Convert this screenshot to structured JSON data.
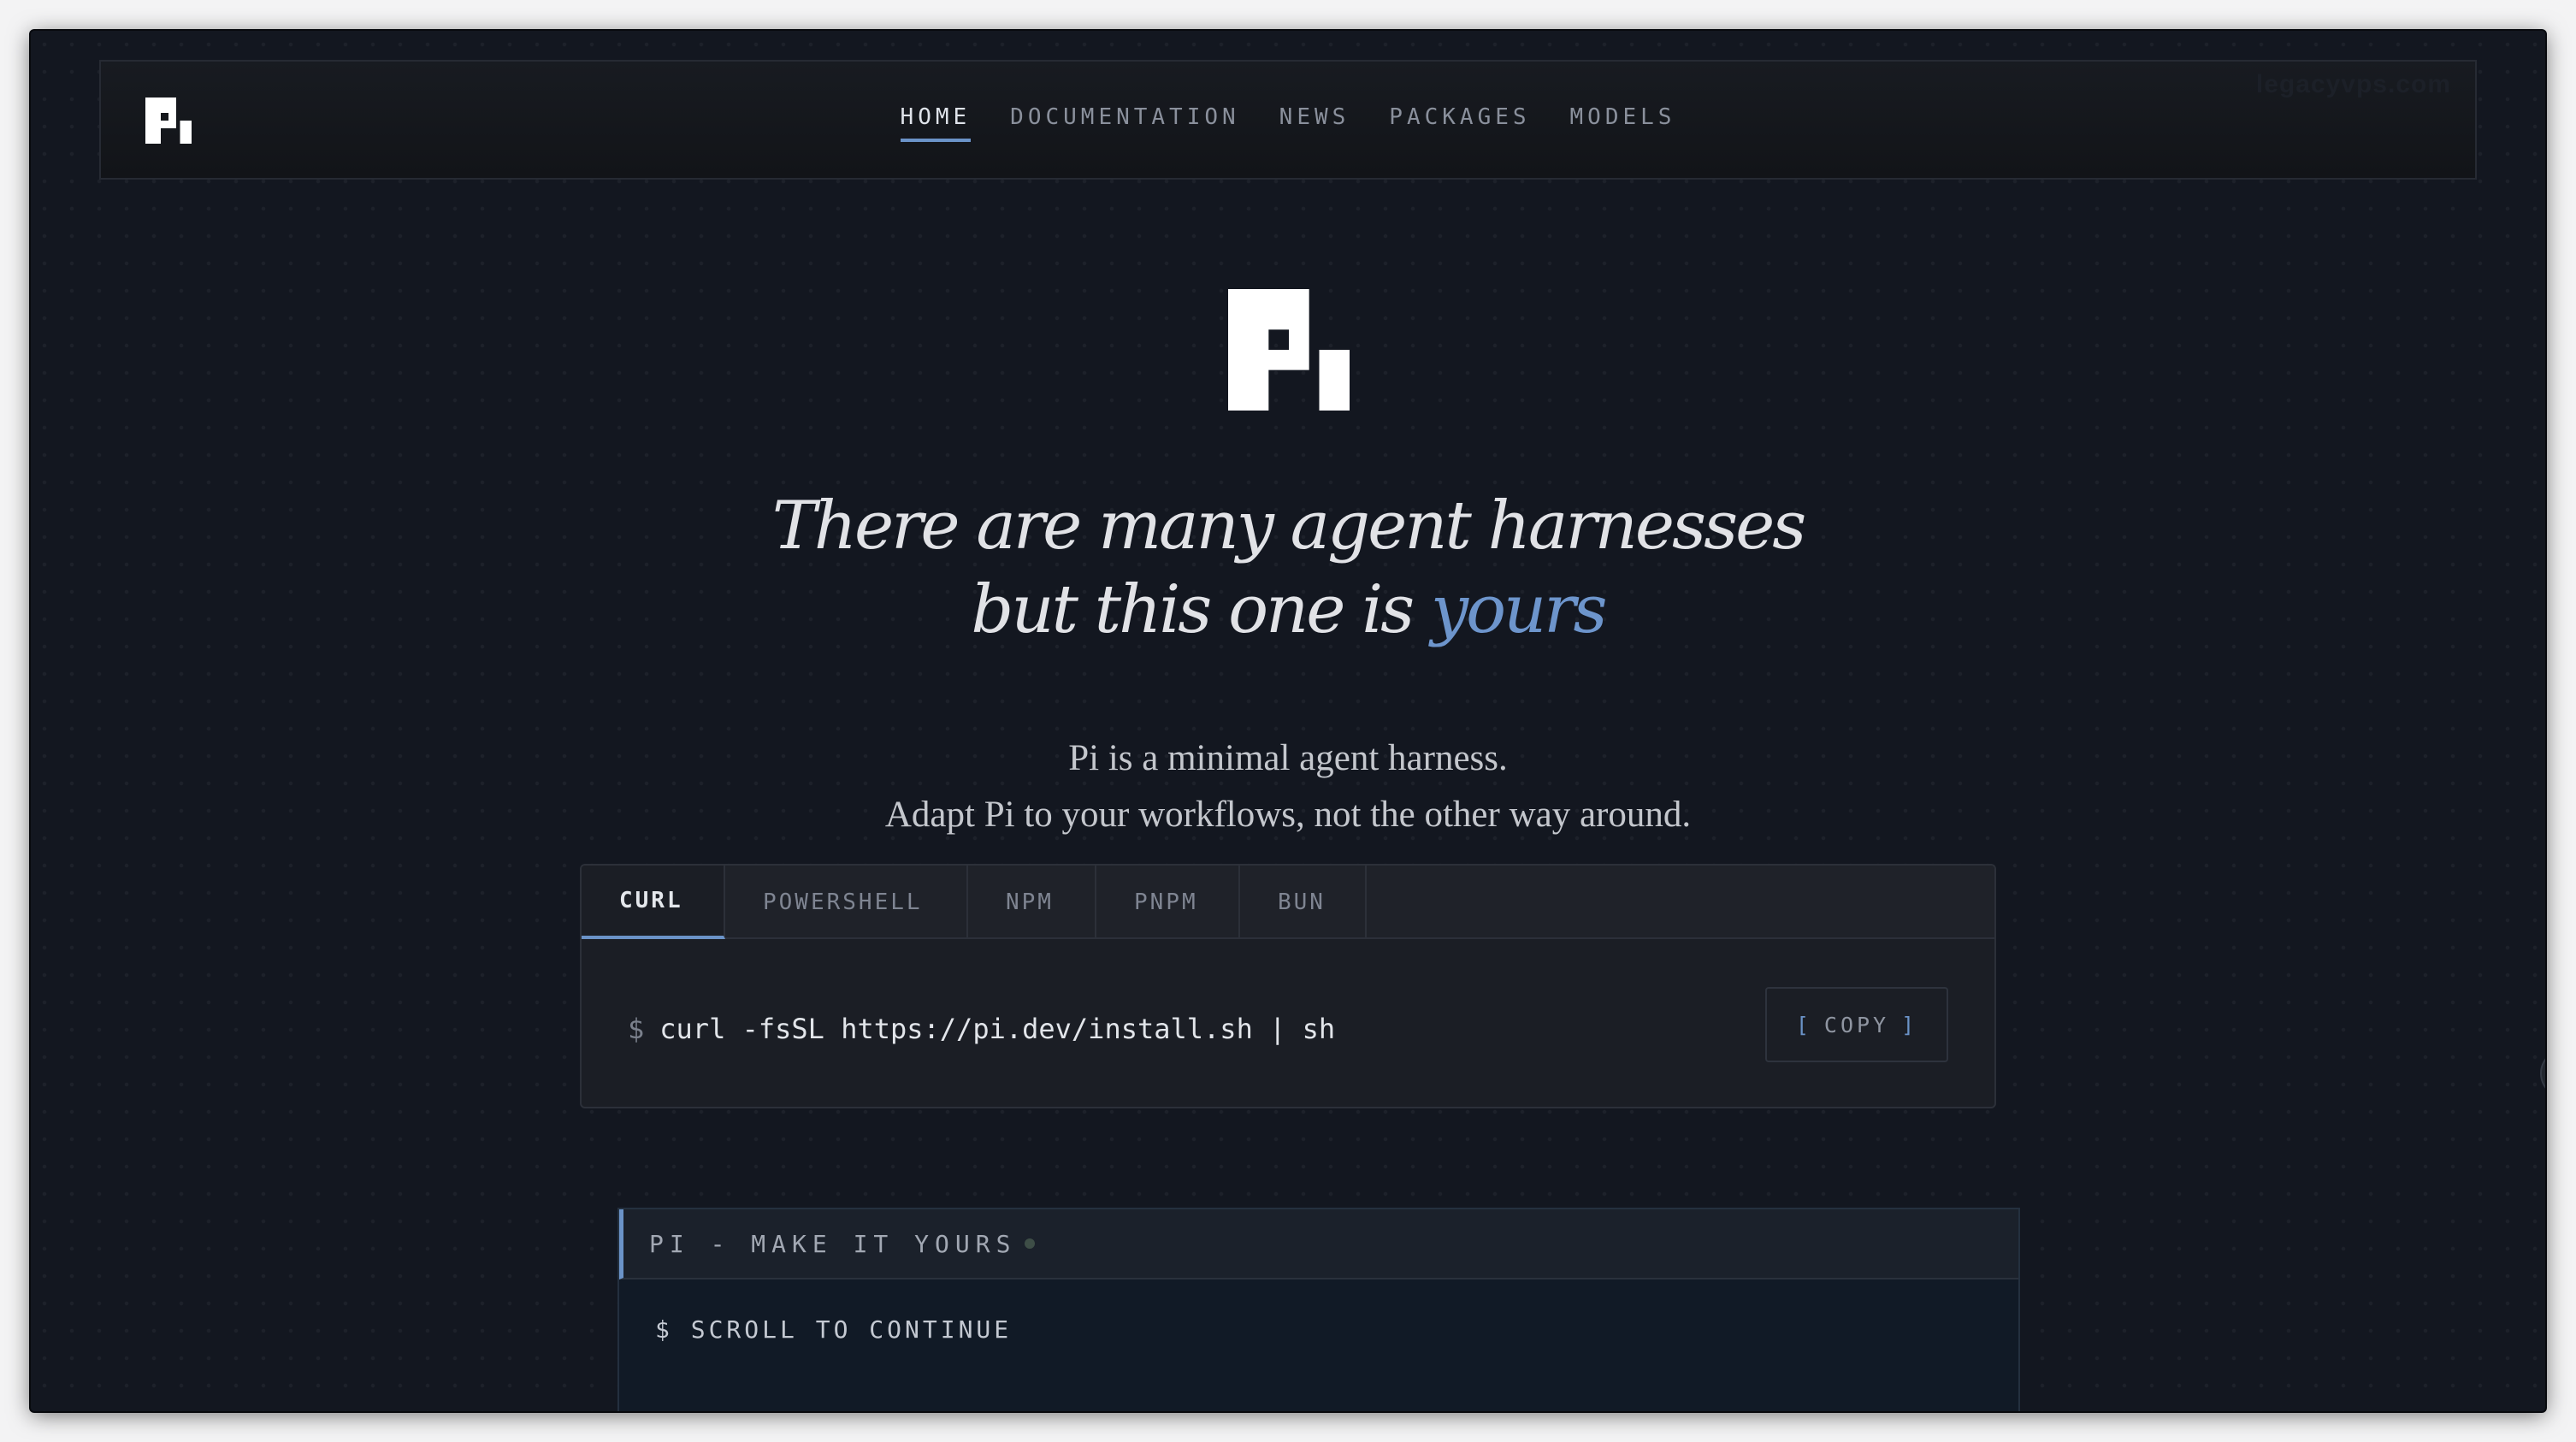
{
  "nav": {
    "items": [
      {
        "label": "HOME",
        "active": true
      },
      {
        "label": "DOCUMENTATION",
        "active": false
      },
      {
        "label": "NEWS",
        "active": false
      },
      {
        "label": "PACKAGES",
        "active": false
      },
      {
        "label": "MODELS",
        "active": false
      }
    ],
    "watermark": "legacyvps.com",
    "logo_icon": "pi-logo-icon"
  },
  "hero": {
    "headline_line1": "There are many agent harnesses",
    "headline_line2_pre": "but this one is ",
    "headline_line2_accent": "yours",
    "tagline_line1": "Pi is a minimal agent harness.",
    "tagline_line2": "Adapt Pi to your workflows, not the other way around."
  },
  "install": {
    "tabs": [
      {
        "label": "CURL",
        "active": true
      },
      {
        "label": "POWERSHELL",
        "active": false
      },
      {
        "label": "NPM",
        "active": false
      },
      {
        "label": "PNPM",
        "active": false
      },
      {
        "label": "BUN",
        "active": false
      }
    ],
    "prompt": "$",
    "command": "curl -fsSL https://pi.dev/install.sh | sh",
    "copy_label": "COPY",
    "copy_open": "[",
    "copy_close": "]"
  },
  "terminal": {
    "title": "PI - MAKE IT YOURS",
    "line": "$ SCROLL TO CONTINUE"
  },
  "colors": {
    "background": "#131720",
    "accent": "#6d95cc",
    "text": "#e1e2e6"
  }
}
